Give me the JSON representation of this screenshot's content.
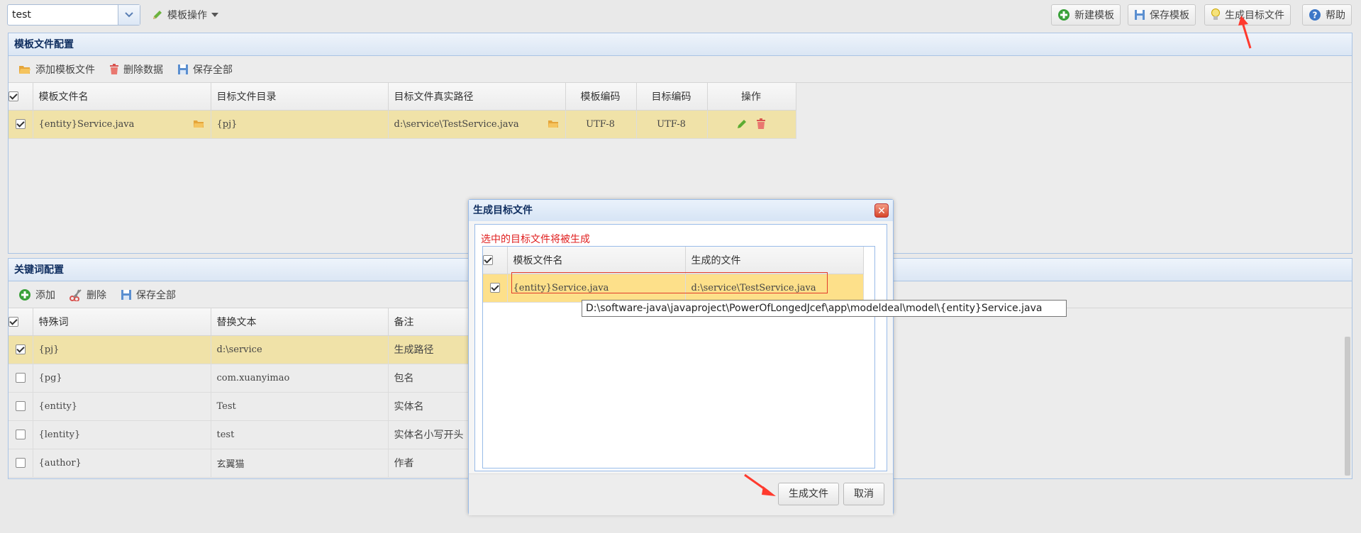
{
  "toolbar": {
    "template_select_value": "test",
    "template_ops_label": "模板操作",
    "new_template_label": "新建模板",
    "save_template_label": "保存模板",
    "generate_target_label": "生成目标文件",
    "help_label": "帮助"
  },
  "template_panel": {
    "title": "模板文件配置",
    "add_label": "添加模板文件",
    "delete_label": "删除数据",
    "save_all_label": "保存全部",
    "columns": [
      "模板文件名",
      "目标文件目录",
      "目标文件真实路径",
      "模板编码",
      "目标编码",
      "操作"
    ],
    "rows": [
      {
        "name": "{entity}Service.java",
        "dir": "{pj}",
        "path": "d:\\service\\TestService.java",
        "tpl_enc": "UTF-8",
        "target_enc": "UTF-8",
        "checked": true
      }
    ]
  },
  "keyword_panel": {
    "title": "关键词配置",
    "add_label": "添加",
    "delete_label": "删除",
    "save_all_label": "保存全部",
    "columns": [
      "特殊词",
      "替换文本",
      "备注"
    ],
    "rows": [
      {
        "word": "{pj}",
        "text": "d:\\service",
        "note": "生成路径",
        "checked": true
      },
      {
        "word": "{pg}",
        "text": "com.xuanyimao",
        "note": "包名",
        "checked": false
      },
      {
        "word": "{entity}",
        "text": "Test",
        "note": "实体名",
        "checked": false
      },
      {
        "word": "{lentity}",
        "text": "test",
        "note": "实体名小写开头",
        "checked": false
      },
      {
        "word": "{author}",
        "text": "玄翼猫",
        "note": "作者",
        "checked": false
      }
    ]
  },
  "dialog": {
    "title": "生成目标文件",
    "hint": "选中的目标文件将被生成",
    "columns": [
      "模板文件名",
      "生成的文件"
    ],
    "rows": [
      {
        "name": "{entity}Service.java",
        "file": "d:\\service\\TestService.java",
        "checked": true
      }
    ],
    "tooltip": "D:\\software-java\\javaproject\\PowerOfLongedJcef\\app\\modeldeal\\model\\{entity}Service.java",
    "generate_label": "生成文件",
    "cancel_label": "取消"
  },
  "colors": {
    "accent": "#99bbe8",
    "selected_row": "#f0e2a8",
    "dialog_selected_row": "#fde08a",
    "hint": "#e02020",
    "annotation": "#ff3a2e"
  }
}
